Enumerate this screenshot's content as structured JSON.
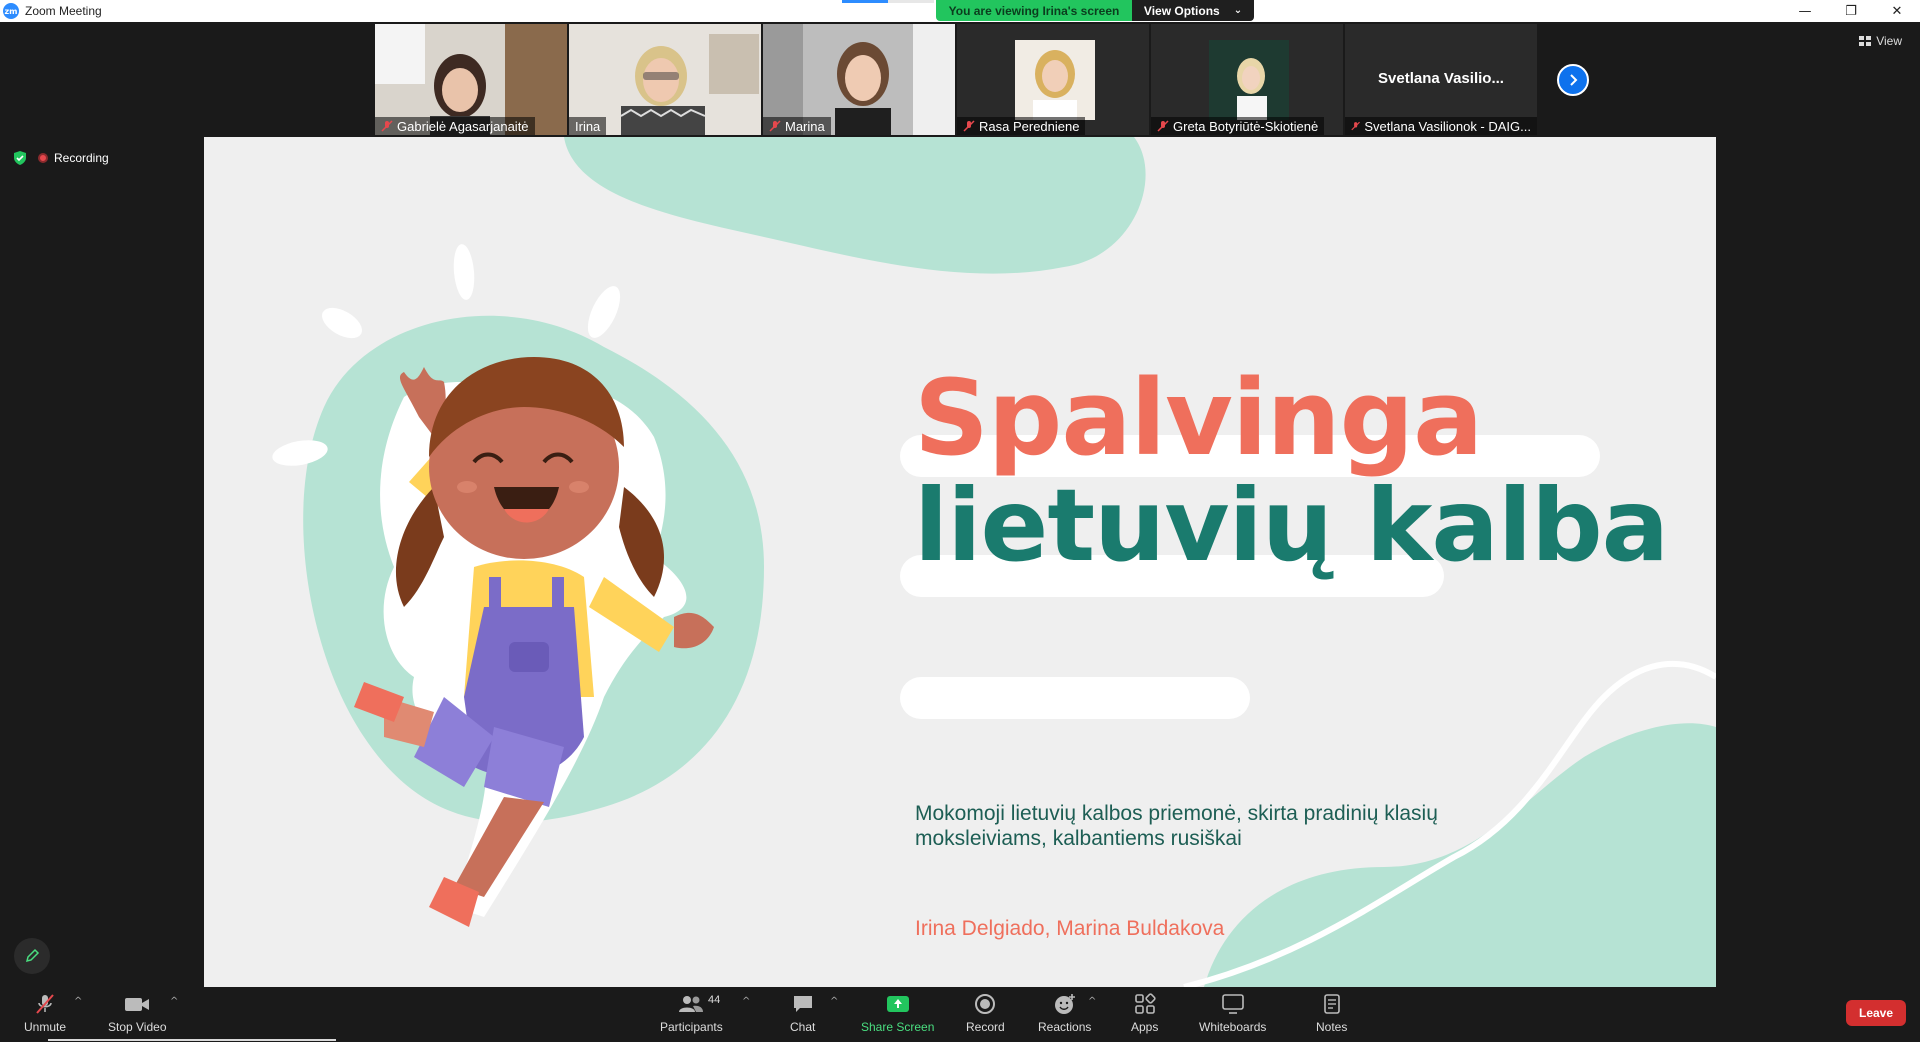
{
  "window": {
    "title": "Zoom Meeting",
    "logo_text": "zm"
  },
  "banner": {
    "viewing": "You are viewing Irina's screen",
    "view_options": "View Options"
  },
  "participants": [
    {
      "name": "Gabrielė Agasarjanaitė",
      "muted": true
    },
    {
      "name": "Irina",
      "muted": false,
      "active": true
    },
    {
      "name": "Marina",
      "muted": true
    },
    {
      "name": "Rasa Peredniene",
      "muted": true
    },
    {
      "name": "Greta Botyriūtė-Skiotienė",
      "muted": true
    },
    {
      "name": "Svetlana Vasilionok - DAIG...",
      "muted": true,
      "display_name": "Svetlana  Vasilio..."
    }
  ],
  "view_button": "View",
  "status": {
    "recording": "Recording"
  },
  "slide": {
    "title_line1": "Spalvinga",
    "title_line2": "lietuvių kalba",
    "subtitle": "Mokomoji lietuvių kalbos priemonė, skirta pradinių klasių moksleiviams, kalbantiems rusiškai",
    "authors": "Irina Delgiado, Marina Buldakova",
    "colors": {
      "coral": "#ef6f5c",
      "teal": "#1a7b6e",
      "mint": "#b6e3d4",
      "background": "#efefef"
    }
  },
  "toolbar": {
    "unmute": "Unmute",
    "stop_video": "Stop Video",
    "participants": "Participants",
    "participants_count": "44",
    "chat": "Chat",
    "share_screen": "Share Screen",
    "record": "Record",
    "reactions": "Reactions",
    "apps": "Apps",
    "whiteboards": "Whiteboards",
    "notes": "Notes",
    "leave": "Leave"
  },
  "colors": {
    "zoom_blue": "#0e72ed",
    "banner_green": "#22c55e",
    "leave_red": "#d32f2f",
    "toolbar_bg": "#1a1a1a"
  }
}
